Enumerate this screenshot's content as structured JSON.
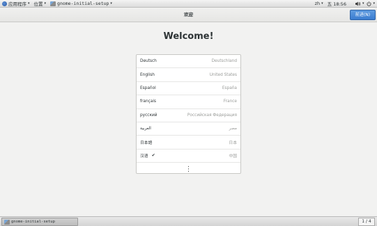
{
  "top_panel": {
    "apps_label": "应用程序",
    "places_label": "位置",
    "window_label": "gnome-initial-setup",
    "input_method": "zh",
    "clock": "五 18:56",
    "dropdown_glyph": "▾"
  },
  "header": {
    "title": "欢迎",
    "next_button": "前进(N)"
  },
  "main": {
    "welcome": "Welcome!",
    "languages": [
      {
        "name": "Deutsch",
        "region": "Deutschland",
        "selected": false
      },
      {
        "name": "English",
        "region": "United States",
        "selected": false
      },
      {
        "name": "Español",
        "region": "España",
        "selected": false
      },
      {
        "name": "français",
        "region": "France",
        "selected": false
      },
      {
        "name": "русский",
        "region": "Российская Федерация",
        "selected": false
      },
      {
        "name": "العربية",
        "region": "مصر",
        "selected": false
      },
      {
        "name": "日本語",
        "region": "日本",
        "selected": false
      },
      {
        "name": "汉语",
        "region": "中国",
        "selected": true,
        "check": "✔"
      }
    ],
    "more_glyph": "⋮"
  },
  "bottom_panel": {
    "task_label": "gnome-initial-setup",
    "workspace": "1 / 4"
  },
  "colors": {
    "accent": "#3a7cd0",
    "background": "#f2f2f1"
  }
}
